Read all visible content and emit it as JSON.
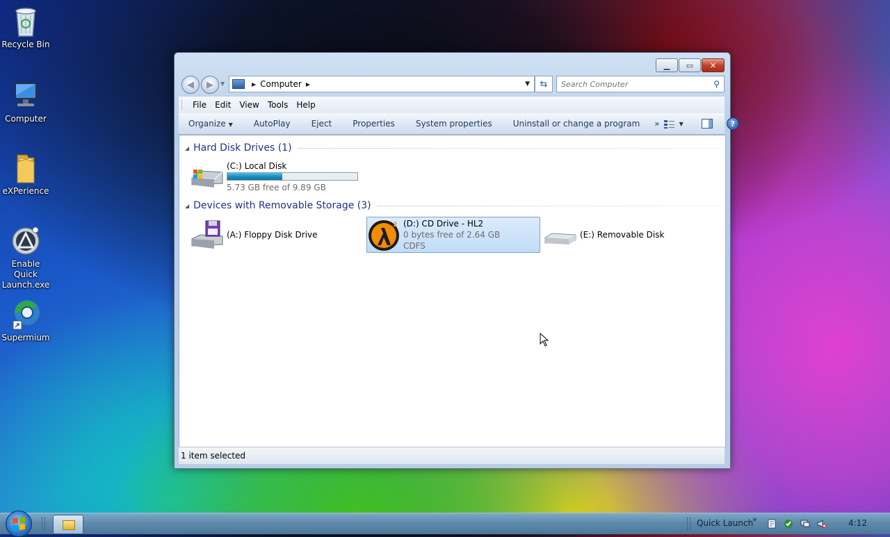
{
  "desktop": {
    "icons": [
      {
        "label": "Recycle Bin",
        "icon": "recycle-bin-icon"
      },
      {
        "label": "Computer",
        "icon": "computer-icon"
      },
      {
        "label": "eXPerience",
        "icon": "folder-icon"
      },
      {
        "label": "Enable Quick Launch.exe",
        "icon": "quick-launch-icon"
      },
      {
        "label": "Supermium",
        "icon": "browser-icon"
      }
    ]
  },
  "window": {
    "address": {
      "location": "Computer"
    },
    "search": {
      "placeholder": "Search Computer"
    },
    "menu": [
      "File",
      "Edit",
      "View",
      "Tools",
      "Help"
    ],
    "commands": [
      "Organize",
      "AutoPlay",
      "Eject",
      "Properties",
      "System properties",
      "Uninstall or change a program"
    ],
    "overflow_glyph": "»",
    "groups": {
      "hard_disks": {
        "label": "Hard Disk Drives (1)"
      },
      "removable": {
        "label": "Devices with Removable Storage (3)"
      }
    },
    "drives": {
      "c": {
        "name": "(C:) Local Disk",
        "space": "5.73 GB free of 9.89 GB",
        "used_fraction": 0.42
      },
      "a": {
        "name": "(A:) Floppy Disk Drive"
      },
      "d": {
        "name": "(D:) CD Drive - HL2",
        "space": "0 bytes free of 2.64 GB",
        "fs": "CDFS"
      },
      "e": {
        "name": "(E:) Removable Disk"
      }
    },
    "status": "1 item selected"
  },
  "taskbar": {
    "quick_launch": "Quick Launch",
    "clock": "4:12"
  },
  "colors": {
    "group_header": "#1e3287",
    "selection": "#c1dcf8",
    "usage_fill": "#1a8fbf"
  }
}
